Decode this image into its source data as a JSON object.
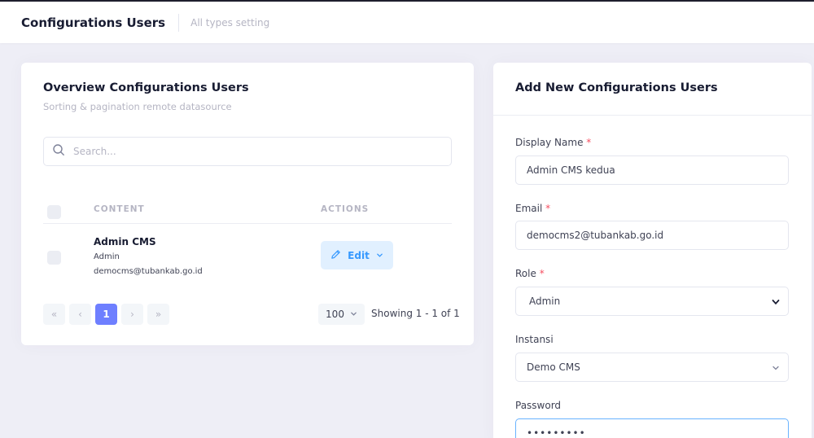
{
  "subheader": {
    "title": "Configurations Users",
    "description": "All types setting"
  },
  "overview": {
    "title": "Overview Configurations Users",
    "subtitle": "Sorting & pagination remote datasource",
    "search": {
      "placeholder": "Search...",
      "value": ""
    },
    "columns": [
      "CONTENT",
      "ACTIONS"
    ],
    "rows": [
      {
        "name": "Admin CMS",
        "role": "Admin",
        "email": "democms@tubankab.go.id",
        "action_label": "Edit"
      }
    ],
    "pagination": {
      "first": "«",
      "prev": "‹",
      "current": "1",
      "next": "›",
      "last": "»",
      "per_page": "100",
      "showing": "Showing 1 - 1 of 1"
    }
  },
  "form": {
    "title": "Add New Configurations Users",
    "required_mark": "*",
    "display_name": {
      "label": "Display Name",
      "value": "Admin CMS kedua"
    },
    "email": {
      "label": "Email",
      "value": "democms2@tubankab.go.id"
    },
    "role": {
      "label": "Role",
      "value": "Admin"
    },
    "instansi": {
      "label": "Instansi",
      "value": "Demo CMS"
    },
    "password": {
      "label": "Password",
      "value": "•••••••••"
    }
  },
  "colors": {
    "accent": "#6e7fff",
    "edit_bg": "#e1f0ff",
    "edit_text": "#3699ff",
    "required": "#f64e60",
    "page_bg": "#eeeef6"
  },
  "icons": {
    "search": "search-icon",
    "edit": "pencil-icon",
    "dropdown": "chevron-down-icon"
  }
}
